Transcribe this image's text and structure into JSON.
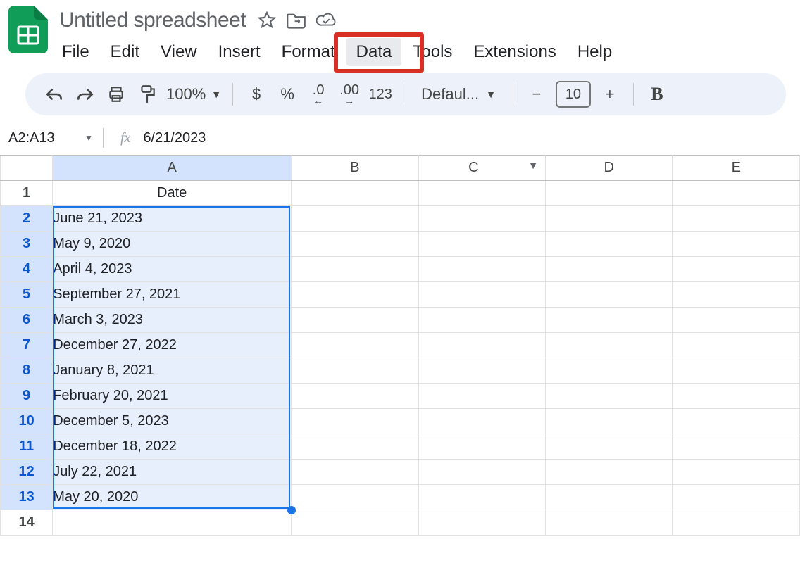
{
  "header": {
    "title": "Untitled spreadsheet",
    "menu": [
      "File",
      "Edit",
      "View",
      "Insert",
      "Format",
      "Data",
      "Tools",
      "Extensions",
      "Help"
    ],
    "highlighted_menu_index": 5
  },
  "toolbar": {
    "zoom": "100%",
    "currency": "$",
    "percent": "%",
    "dec_dec": ".0",
    "inc_dec": ".00",
    "num123": "123",
    "font": "Defaul...",
    "minus": "−",
    "font_size": "10",
    "plus": "+",
    "bold": "B"
  },
  "namebox": {
    "range": "A2:A13",
    "fx_label": "fx",
    "formula": "6/21/2023"
  },
  "columns": [
    "A",
    "B",
    "C",
    "D",
    "E"
  ],
  "rows": [
    1,
    2,
    3,
    4,
    5,
    6,
    7,
    8,
    9,
    10,
    11,
    12,
    13,
    14
  ],
  "selected_rows_start": 2,
  "selected_rows_end": 13,
  "data": {
    "header_cell": "Date",
    "A": [
      "June 21, 2023",
      "May 9, 2020",
      "April 4, 2023",
      "September 27, 2021",
      "March 3, 2023",
      "December 27, 2022",
      "January 8, 2021",
      "February 20, 2021",
      "December 5, 2023",
      "December 18, 2022",
      "July 22, 2021",
      "May 20, 2020"
    ]
  }
}
